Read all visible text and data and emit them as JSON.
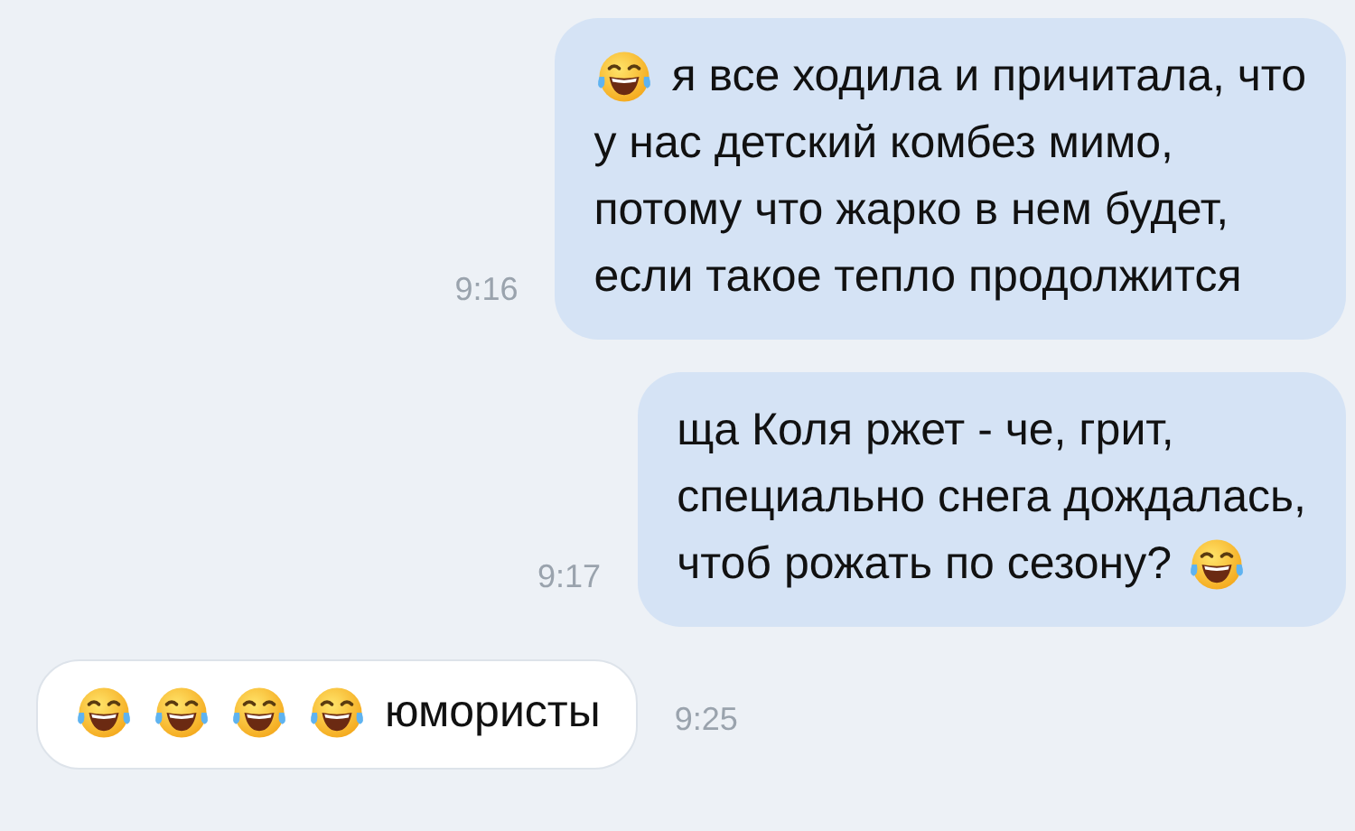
{
  "messages": [
    {
      "outgoing": true,
      "time": "9:16",
      "lines": [
        [
          {
            "kind": "emoji"
          },
          {
            "kind": "text",
            "text": "я все ходила и причитала, что"
          }
        ],
        [
          {
            "kind": "text",
            "text": "у нас детский комбез мимо,"
          }
        ],
        [
          {
            "kind": "text",
            "text": "потому что жарко в нем будет,"
          }
        ],
        [
          {
            "kind": "text",
            "text": "если такое тепло продолжится"
          }
        ]
      ]
    },
    {
      "outgoing": true,
      "time": "9:17",
      "lines": [
        [
          {
            "kind": "text",
            "text": "ща Коля ржет - че, грит,"
          }
        ],
        [
          {
            "kind": "text",
            "text": "специально снега дождалась,"
          }
        ],
        [
          {
            "kind": "text",
            "text": "чтоб рожать по сезону?"
          },
          {
            "kind": "emoji"
          }
        ]
      ]
    },
    {
      "outgoing": false,
      "time": "9:25",
      "lines": [
        [
          {
            "kind": "emoji"
          },
          {
            "kind": "emoji"
          },
          {
            "kind": "emoji"
          },
          {
            "kind": "emoji"
          },
          {
            "kind": "text",
            "text": "юмористы"
          }
        ]
      ]
    }
  ]
}
